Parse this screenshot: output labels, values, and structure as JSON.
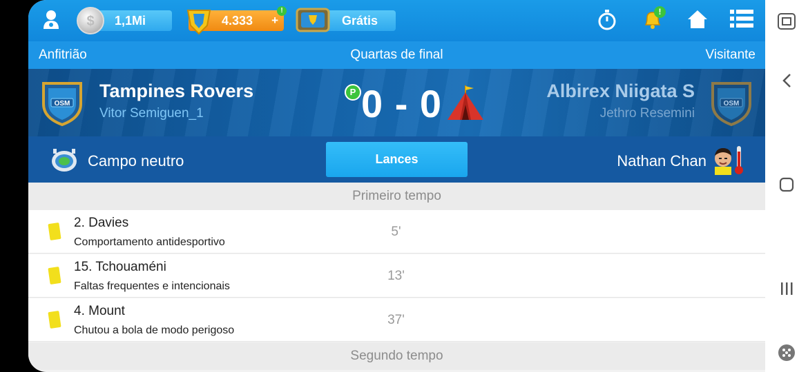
{
  "topbar": {
    "coins": "1,1Mi",
    "gems": "4.333",
    "gems_plus": "+",
    "tv_label": "Grátis",
    "notif_badge": "!",
    "gem_badge": "!"
  },
  "round": {
    "home_label": "Anfitrião",
    "stage": "Quartas de final",
    "away_label": "Visitante"
  },
  "match": {
    "home_team": "Tampines Rovers",
    "home_manager": "Vitor Semiguen_1",
    "away_team": "Albirex Niigata S",
    "away_manager": "Jethro Resemini",
    "score": "0 - 0",
    "badge_text": "OSM",
    "penalty_badge": "P"
  },
  "info": {
    "venue": "Campo neutro",
    "button": "Lances",
    "referee": "Nathan Chan"
  },
  "sections": {
    "first_half": "Primeiro tempo",
    "second_half": "Segundo tempo"
  },
  "events": [
    {
      "player": "2. Davies",
      "reason": "Comportamento antidesportivo",
      "minute": "5'"
    },
    {
      "player": "15. Tchouaméni",
      "reason": "Faltas frequentes e intencionais",
      "minute": "13'"
    },
    {
      "player": "4. Mount",
      "reason": "Chutou a bola de modo perigoso",
      "minute": "37'"
    }
  ],
  "colors": {
    "topbar": "#1a9be8",
    "scoreboard": "#1566ae",
    "button": "#1aa6ee",
    "yellow_card": "#f2df1c"
  }
}
